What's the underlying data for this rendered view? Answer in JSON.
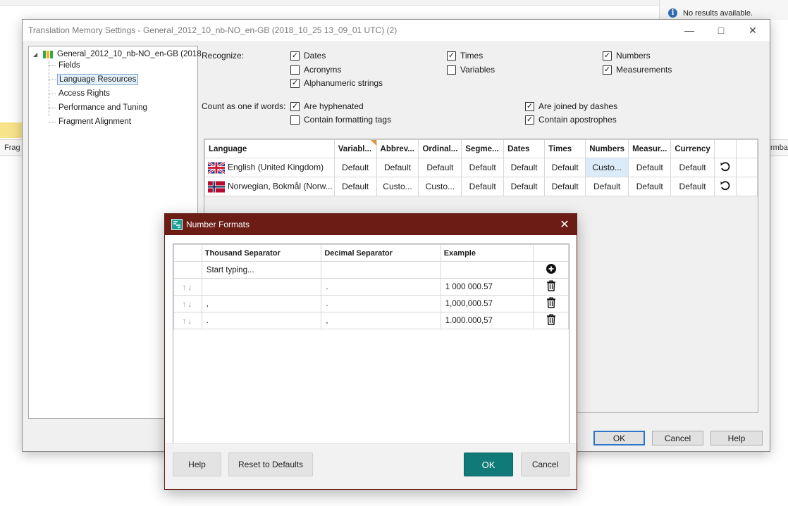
{
  "background_app": {
    "info_text": "No results available.",
    "fragment_label_left": "Frag",
    "fragment_label_right": "rmba"
  },
  "tm_settings": {
    "title": "Translation Memory Settings - General_2012_10_nb-NO_en-GB (2018_10_25 13_09_01 UTC) (2)",
    "tree": {
      "root": "General_2012_10_nb-NO_en-GB (2018",
      "items": [
        "Fields",
        "Language Resources",
        "Access Rights",
        "Performance and Tuning",
        "Fragment Alignment"
      ],
      "selected": "Language Resources"
    },
    "recognize": {
      "label": "Recognize:",
      "options": [
        {
          "label": "Dates",
          "checked": true
        },
        {
          "label": "Times",
          "checked": true
        },
        {
          "label": "Numbers",
          "checked": true
        },
        {
          "label": "Acronyms",
          "checked": false
        },
        {
          "label": "Variables",
          "checked": false
        },
        {
          "label": "Measurements",
          "checked": true
        },
        {
          "label": "Alphanumeric strings",
          "checked": true
        }
      ]
    },
    "count_as_one": {
      "label": "Count as one if words:",
      "options": [
        {
          "label": "Are hyphenated",
          "checked": true
        },
        {
          "label": "Are joined by dashes",
          "checked": true
        },
        {
          "label": "Contain formatting tags",
          "checked": false
        },
        {
          "label": "Contain apostrophes",
          "checked": true
        }
      ]
    },
    "grid": {
      "columns": [
        "Language",
        "Variabl...",
        "Abbrev...",
        "Ordinal...",
        "Segme...",
        "Dates",
        "Times",
        "Numbers",
        "Measur...",
        "Currency"
      ],
      "rows": [
        {
          "language": "English (United Kingdom)",
          "values": [
            "Default",
            "Default",
            "Default",
            "Default",
            "Default",
            "Default",
            "Custo...",
            "Default",
            "Default"
          ]
        },
        {
          "language": "Norwegian, Bokmål (Norw...",
          "values": [
            "Default",
            "Custo...",
            "Custo...",
            "Default",
            "Default",
            "Default",
            "Default",
            "Default",
            "Default"
          ]
        }
      ]
    },
    "buttons": {
      "ok": "OK",
      "cancel": "Cancel",
      "help": "Help"
    }
  },
  "number_formats": {
    "title": "Number Formats",
    "columns": [
      "Thousand Separator",
      "Decimal Separator",
      "Example"
    ],
    "new_row_placeholder": "Start typing...",
    "rows": [
      {
        "thousand": "",
        "decimal": ".",
        "example": "1 000 000.57"
      },
      {
        "thousand": ",",
        "decimal": ".",
        "example": "1,000,000.57"
      },
      {
        "thousand": ".",
        "decimal": ",",
        "example": "1.000.000,57"
      }
    ],
    "buttons": {
      "help": "Help",
      "reset": "Reset to Defaults",
      "ok": "OK",
      "cancel": "Cancel"
    }
  }
}
